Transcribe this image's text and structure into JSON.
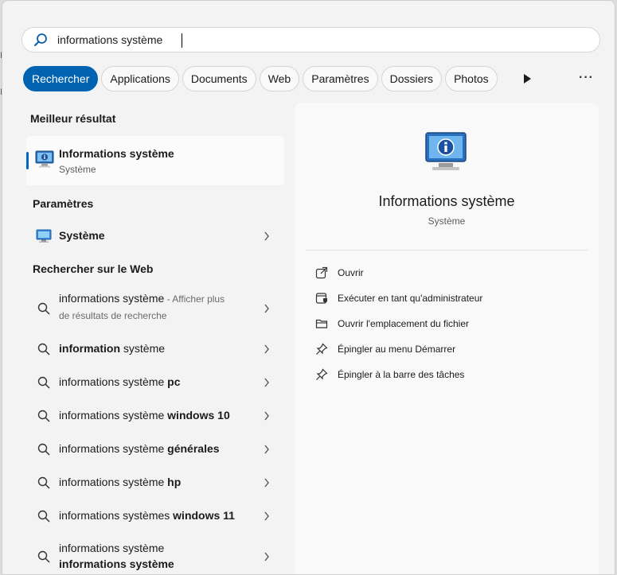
{
  "search": {
    "value": "informations système",
    "placeholder": ""
  },
  "filters": [
    {
      "label": "Rechercher",
      "active": true
    },
    {
      "label": "Applications"
    },
    {
      "label": "Documents"
    },
    {
      "label": "Web"
    },
    {
      "label": "Paramètres"
    },
    {
      "label": "Dossiers"
    },
    {
      "label": "Photos"
    }
  ],
  "sections": {
    "best": "Meilleur résultat",
    "settings": "Paramètres",
    "web": "Rechercher sur le Web"
  },
  "best_result": {
    "title": "Informations système",
    "subtitle": "Système"
  },
  "settings_item": {
    "label": "Système"
  },
  "web_results": [
    {
      "plain": "informations système",
      "muted": " - Afficher plus",
      "line2": "de résultats de recherche"
    },
    {
      "bold": "information",
      "plain": " système"
    },
    {
      "plain": "informations système ",
      "bold": "pc"
    },
    {
      "plain": "informations système ",
      "bold": "windows 10"
    },
    {
      "plain": "informations système ",
      "bold": "générales"
    },
    {
      "plain": "informations système ",
      "bold": "hp"
    },
    {
      "plain": "informations systèmes ",
      "bold": "windows 11"
    },
    {
      "plain": "informations système",
      "line2bold": "informations système"
    }
  ],
  "detail": {
    "title": "Informations système",
    "subtitle": "Système",
    "actions": [
      {
        "label": "Ouvrir",
        "icon": "open-external-icon"
      },
      {
        "label": "Exécuter en tant qu'administrateur",
        "icon": "admin-shield-icon"
      },
      {
        "label": "Ouvrir l'emplacement du fichier",
        "icon": "folder-icon"
      },
      {
        "label": "Épingler au menu Démarrer",
        "icon": "pin-icon"
      },
      {
        "label": "Épingler à la barre des tâches",
        "icon": "pin-icon"
      }
    ]
  },
  "colors": {
    "accent": "#0063b1",
    "background": "#f3f3f3"
  }
}
